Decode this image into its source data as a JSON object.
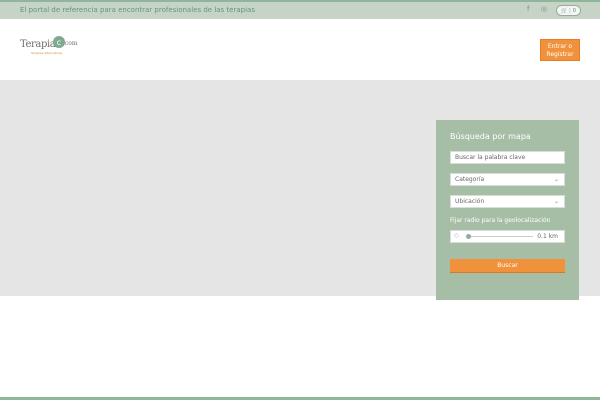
{
  "topbar": {
    "tagline": "El portal de referencia para encontrar profesionales de las terapias",
    "facebook_icon": "f",
    "instagram_icon": "◎",
    "cart_icon": "🛒",
    "cart_count": "0"
  },
  "header": {
    "logo_text": "Terapia",
    "logo_badge": "c",
    "logo_suffix": ".com",
    "logo_subtitle": "Terapias alternativas",
    "login_label": "Entrar o\nRegistrar"
  },
  "search_panel": {
    "title": "Búsqueda por mapa",
    "keyword_placeholder": "Buscar la palabra clave",
    "category_label": "Categoría",
    "location_label": "Ubicación",
    "radius_label": "Fijar radio para la geolocalización",
    "radius_value": "0.1 km",
    "radius_fraction": 0.0,
    "search_button": "Buscar"
  },
  "colors": {
    "brand_green": "#8fb59b",
    "panel_green": "#a6bea6",
    "accent_orange": "#f0923b",
    "map_gray": "#e5e5e5"
  }
}
